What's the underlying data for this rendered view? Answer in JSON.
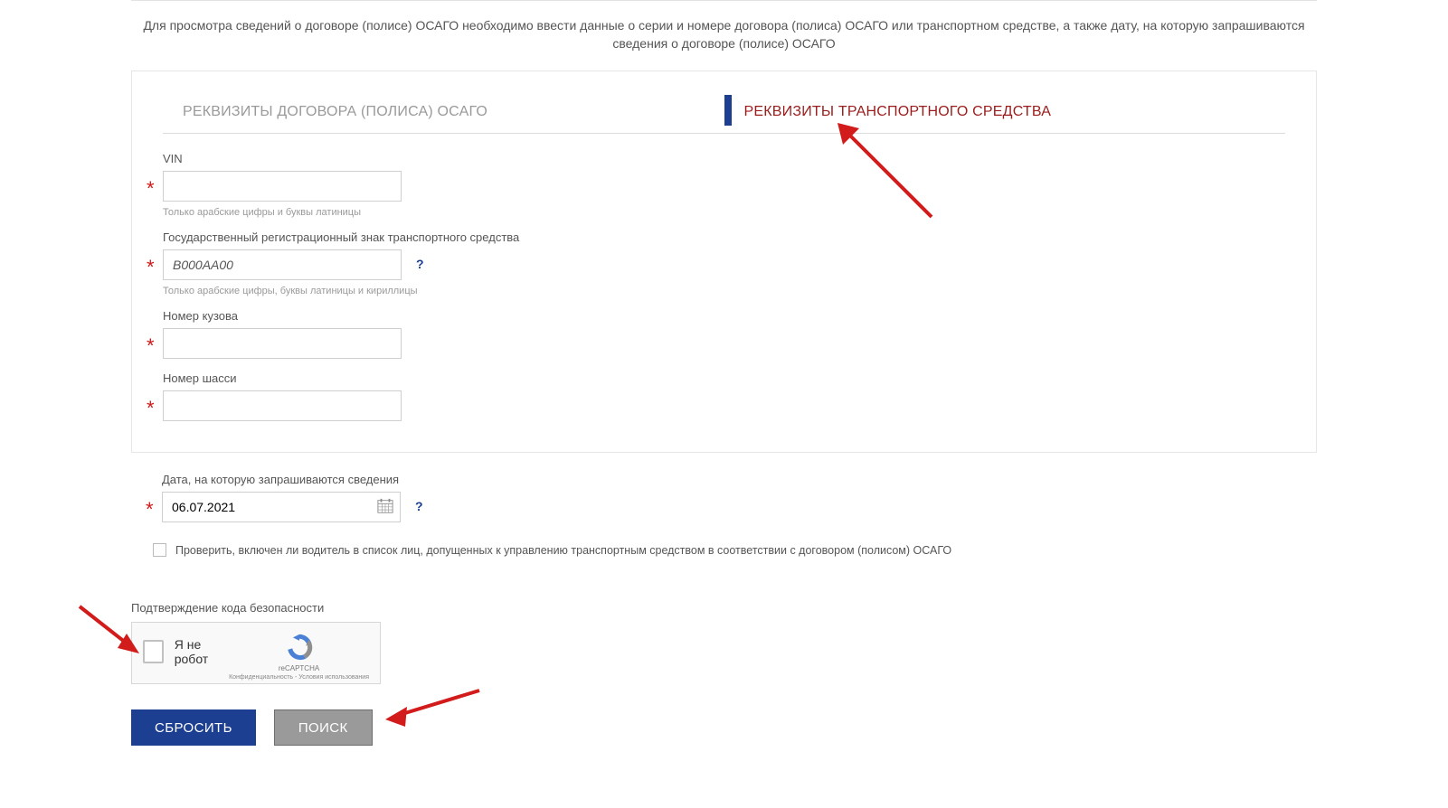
{
  "intro": "Для просмотра сведений о договоре (полисе) ОСАГО необходимо ввести данные о серии и номере договора (полиса) ОСАГО или транспортном средстве, а также дату, на которую запрашиваются сведения о договоре (полисе) ОСАГО",
  "tabs": {
    "policy": "РЕКВИЗИТЫ ДОГОВОРА (ПОЛИСА) ОСАГО",
    "vehicle": "РЕКВИЗИТЫ ТРАНСПОРТНОГО СРЕДСТВА"
  },
  "fields": {
    "vin": {
      "label": "VIN",
      "value": "",
      "hint": "Только арабские цифры и буквы латиницы"
    },
    "grz": {
      "label": "Государственный регистрационный знак транспортного средства",
      "value": "В000АА00",
      "hint": "Только арабские цифры, буквы латиницы и кириллицы"
    },
    "body": {
      "label": "Номер кузова",
      "value": ""
    },
    "chassis": {
      "label": "Номер шасси",
      "value": ""
    },
    "date": {
      "label": "Дата, на которую запрашиваются сведения",
      "value": "06.07.2021"
    }
  },
  "checkbox_text": "Проверить, включен ли водитель в список лиц, допущенных к управлению транспортным средством в соответствии с договором (полисом) ОСАГО",
  "captcha": {
    "section_title": "Подтверждение кода безопасности",
    "im_not_robot": "Я не робот",
    "brand": "reCAPTCHA",
    "privacy": "Конфиденциальность - Условия использования"
  },
  "buttons": {
    "reset": "СБРОСИТЬ",
    "search": "ПОИСК"
  },
  "help_char": "?",
  "star_char": "*"
}
